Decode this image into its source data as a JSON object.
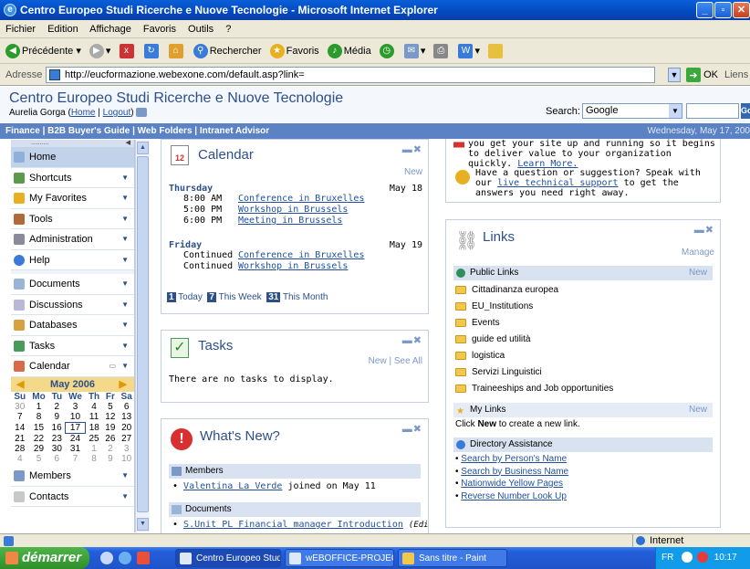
{
  "window": {
    "title": "Centro Europeo Studi Ricerche e Nuove Tecnologie - Microsoft Internet Explorer"
  },
  "menu": [
    "Fichier",
    "Edition",
    "Affichage",
    "Favoris",
    "Outils",
    "?"
  ],
  "toolbar": {
    "back": "Précédente",
    "search": "Rechercher",
    "favorites": "Favoris",
    "media": "Média"
  },
  "address": {
    "label": "Adresse",
    "url": "http://eucformazione.webexone.com/default.asp?link=",
    "go": "OK",
    "links": "Liens"
  },
  "site": {
    "title": "Centro Europeo Studi Ricerche e Nuove Tecnologie",
    "user": "Aurelia Gorga (",
    "home_link": "Home",
    "sep": "|",
    "logout_link": "Logout",
    "user_end": ")",
    "search_label": "Search:",
    "search_engine": "Google",
    "search_go": "Go"
  },
  "nav": {
    "links": "Finance | B2B Buyer's Guide | Web Folders | Intranet Advisor",
    "date": "Wednesday, May 17, 200"
  },
  "sidebar": {
    "top": "..........",
    "items": [
      "Home",
      "Shortcuts",
      "My Favorites",
      "Tools",
      "Administration",
      "Help",
      "Documents",
      "Discussions",
      "Databases",
      "Tasks",
      "Calendar"
    ],
    "bottom_items": [
      "Members",
      "Contacts"
    ]
  },
  "mini_cal": {
    "month": "May 2006",
    "days": [
      "Su",
      "Mo",
      "Tu",
      "We",
      "Th",
      "Fr",
      "Sa"
    ],
    "weeks": [
      [
        "30",
        "1",
        "2",
        "3",
        "4",
        "5",
        "6"
      ],
      [
        "7",
        "8",
        "9",
        "10",
        "11",
        "12",
        "13"
      ],
      [
        "14",
        "15",
        "16",
        "17",
        "18",
        "19",
        "20"
      ],
      [
        "21",
        "22",
        "23",
        "24",
        "25",
        "26",
        "27"
      ],
      [
        "28",
        "29",
        "30",
        "31",
        "1",
        "2",
        "3"
      ],
      [
        "4",
        "5",
        "6",
        "7",
        "8",
        "9",
        "10"
      ]
    ]
  },
  "calendar": {
    "title": "Calendar",
    "new": "New",
    "day1": {
      "name": "Thursday",
      "date": "May 18",
      "events": [
        {
          "time": "8:00 AM",
          "title": "Conference in Bruxelles"
        },
        {
          "time": "5:00 PM",
          "title": "Workshop in Brussels"
        },
        {
          "time": "6:00 PM",
          "title": "Meeting in Brussels"
        }
      ]
    },
    "day2": {
      "name": "Friday",
      "date": "May 19",
      "events": [
        {
          "time": "Continued",
          "title": "Conference in Bruxelles"
        },
        {
          "time": "Continued",
          "title": "Workshop in Brussels"
        }
      ]
    },
    "views": [
      "Today",
      "This Week",
      "This Month"
    ],
    "view_icons": [
      "1",
      "7",
      "31"
    ]
  },
  "tasks": {
    "title": "Tasks",
    "new": "New",
    "see_all": "See All",
    "sep": "|",
    "empty": "There are no tasks to display."
  },
  "whats_new": {
    "title": "What's New?",
    "members_label": "Members",
    "member_name": "Valentina La Verde",
    "member_text": "joined on May 11",
    "documents_label": "Documents",
    "doc_name": "S.Unit PL Financial manager Introduction",
    "doc_note": "(Edited on May"
  },
  "intro": {
    "text1": "you get your site up and running so it begins to deliver value to your organization quickly.",
    "learn_more": "Learn More.",
    "text2": "Have a question or suggestion? Speak with our",
    "support_link": "live technical support",
    "text3": "to get the answers you need right away."
  },
  "links_panel": {
    "title": "Links",
    "manage": "Manage",
    "public_label": "Public Links",
    "public_new": "New",
    "public_items": [
      "Cittadinanza europea",
      "EU_Institutions",
      "Events",
      "guide ed utilità",
      "logistica",
      "Servizi Linguistici",
      "Traineeships and Job opportunities"
    ],
    "my_label": "My Links",
    "my_new": "New",
    "my_click": "Click",
    "my_new_bold": "New",
    "my_rest": "to create a new link.",
    "dir_label": "Directory Assistance",
    "dir_items": [
      "Search by Person's Name",
      "Search by Business Name",
      "Nationwide Yellow Pages",
      "Reverse Number Look Up"
    ]
  },
  "status": {
    "zone": "Internet"
  },
  "taskbar": {
    "start": "démarrer",
    "tasks": [
      "Centro Europeo Studi...",
      "wEBOFFICE-PROJEC...",
      "Sans titre - Paint"
    ],
    "lang": "FR",
    "time": "10:17"
  }
}
